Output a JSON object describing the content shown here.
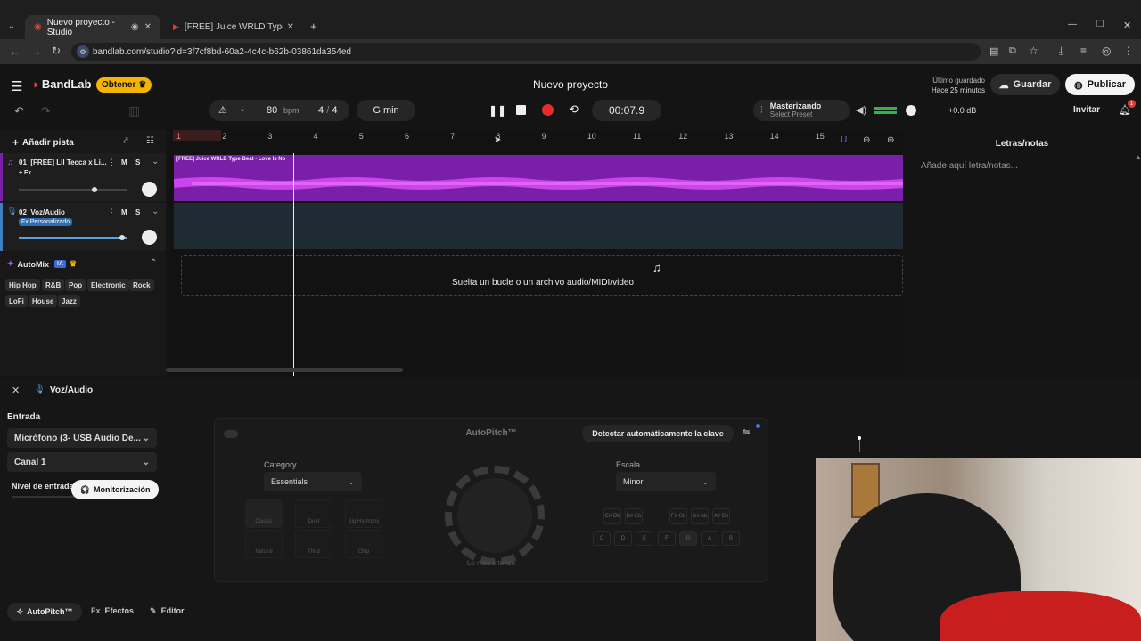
{
  "browser": {
    "tabs": [
      {
        "title": "Nuevo proyecto - Studio",
        "active": true
      },
      {
        "title": "[FREE] Juice WRLD Type Beat - ",
        "active": false
      }
    ],
    "url": "bandlab.com/studio?id=3f7cf8bd-60a2-4c4c-b62b-03861da354ed"
  },
  "header": {
    "brand": "BandLab",
    "upgrade_label": "Obtener",
    "project_title": "Nuevo proyecto",
    "save_status_line1": "Último guardado",
    "save_status_line2": "Hace 25 minutos",
    "save_label": "Guardar",
    "publish_label": "Publicar",
    "invite_label": "Invitar",
    "notifications_count": "1"
  },
  "transport": {
    "bpm": "80",
    "bpm_unit": "bpm",
    "time_sig_num": "4",
    "time_sig_sep": "/",
    "time_sig_den": "4",
    "key": "G min",
    "time": "00:07.9",
    "mastering_label": "Masterizando",
    "mastering_preset": "Select Preset",
    "volume_db": "+0.0 dB"
  },
  "tracks_panel": {
    "add_track_label": "Añadir pista",
    "tracks": [
      {
        "number": "01",
        "name": "[FREE] Lil Tecca x Li...",
        "mute": "M",
        "solo": "S",
        "fx_label": "+ Fx",
        "volume": 0.7,
        "fx_custom": false
      },
      {
        "number": "02",
        "name": "Voz/Audio",
        "mute": "M",
        "solo": "S",
        "fx_label": "Fx Personalizado",
        "volume": 0.95,
        "fx_custom": true
      }
    ],
    "automix": {
      "title": "AutoMix",
      "ai_badge": "IA",
      "genres": [
        "Hip Hop",
        "R&B",
        "Pop",
        "Electronic",
        "Rock",
        "LoFi",
        "House",
        "Jazz"
      ]
    }
  },
  "timeline": {
    "ruler": [
      "1",
      "2",
      "3",
      "4",
      "5",
      "6",
      "7",
      "8",
      "9",
      "10",
      "11",
      "12",
      "13",
      "14",
      "15"
    ],
    "clip1_label": "[FREE] Juice WRLD Type Beat - Love Is No",
    "drop_label": "Suelta un bucle o un archivo audio/MIDI/video"
  },
  "lyrics": {
    "title": "Letras/notas",
    "placeholder": "Añade aquí letra/notas..."
  },
  "bottom": {
    "track_title": "Voz/Audio",
    "input_label": "Entrada",
    "input_device": "Micrófono (3- USB Audio De...",
    "channel": "Canal 1",
    "level_label": "Nivel de entrada",
    "monitor_label": "Monitorización",
    "autopitch_title": "AutoPitch™",
    "detect_key_label": "Detectar automáticamente la clave",
    "category_label": "Category",
    "category_value": "Essentials",
    "scale_label": "Escala",
    "scale_value": "Minor",
    "knob_label": "Lo más intenso",
    "effects": [
      {
        "label": "Classic"
      },
      {
        "label": "Duet"
      },
      {
        "label": "Big Harmony"
      },
      {
        "label": "Natural"
      },
      {
        "label": "Third"
      },
      {
        "label": "Chip"
      }
    ],
    "sharp_keys": [
      "C#\nDb",
      "D#\nEb",
      "F#\nGb",
      "G#\nAb",
      "A#\nBb"
    ],
    "natural_keys": [
      "C",
      "D",
      "E",
      "F",
      "G",
      "A",
      "B"
    ],
    "tabs": [
      {
        "label": "AutoPitch™",
        "active": true
      },
      {
        "label": "Efectos",
        "active": false
      },
      {
        "label": "Editor",
        "active": false
      }
    ]
  }
}
